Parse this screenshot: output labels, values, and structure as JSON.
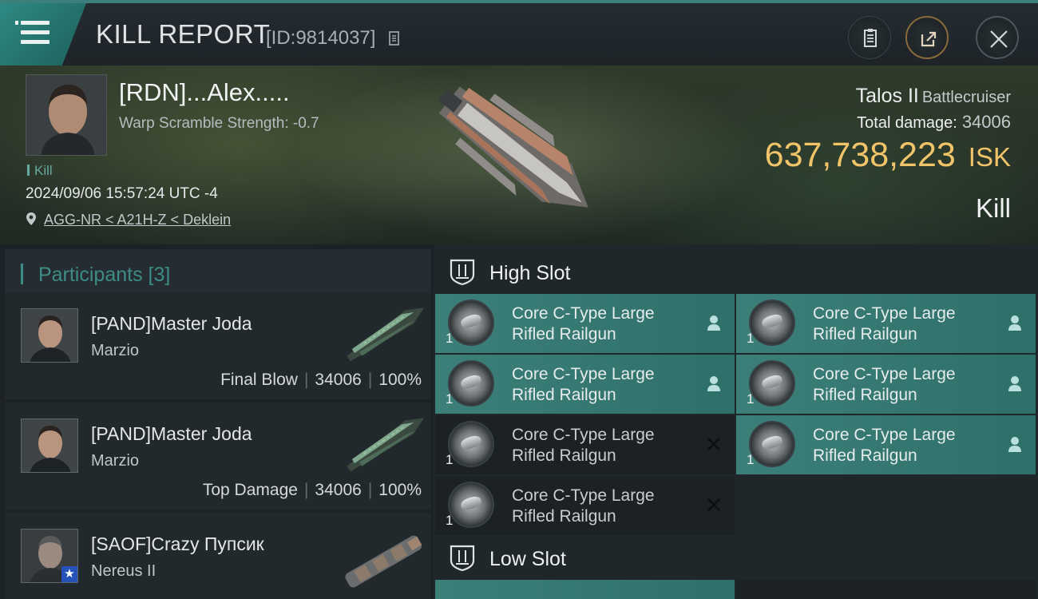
{
  "header": {
    "title": "KILL REPORT",
    "report_id": "[ID:9814037]"
  },
  "victim": {
    "name": "[RDN]...Alex.....",
    "warp_scramble": "Warp Scramble Strength: -0.7",
    "kill_tag": "Kill",
    "datetime": "2024/09/06 15:57:24 UTC -4",
    "location": "AGG-NR < A21H-Z < Deklein",
    "ship": "Talos II",
    "ship_class": "Battlecruiser",
    "total_damage_label": "Total damage:",
    "total_damage": "34006",
    "isk_value": "637,738,223",
    "isk_unit": "ISK",
    "result": "Kill"
  },
  "participants": {
    "label": "Participants",
    "count": "[3]",
    "items": [
      {
        "name": "[PAND]Master Joda",
        "ship": "Marzio",
        "role": "Final Blow",
        "damage": "34006",
        "pct": "100%"
      },
      {
        "name": "[PAND]Master Joda",
        "ship": "Marzio",
        "role": "Top Damage",
        "damage": "34006",
        "pct": "100%"
      },
      {
        "name": "[SAOF]Crazy Пупсик",
        "ship": "Nereus II",
        "role": "",
        "damage": "",
        "pct": ""
      }
    ]
  },
  "slots": {
    "high_label": "High Slot",
    "low_label": "Low Slot",
    "high": [
      {
        "name_l1": "Core C-Type Large",
        "name_l2": "Rifled Railgun",
        "qty": "1",
        "status": "fitted"
      },
      {
        "name_l1": "Core C-Type Large",
        "name_l2": "Rifled Railgun",
        "qty": "1",
        "status": "fitted"
      },
      {
        "name_l1": "Core C-Type Large",
        "name_l2": "Rifled Railgun",
        "qty": "1",
        "status": "fitted"
      },
      {
        "name_l1": "Core C-Type Large",
        "name_l2": "Rifled Railgun",
        "qty": "1",
        "status": "fitted"
      },
      {
        "name_l1": "Core C-Type Large",
        "name_l2": "Rifled Railgun",
        "qty": "1",
        "status": "destroyed"
      },
      {
        "name_l1": "Core C-Type Large",
        "name_l2": "Rifled Railgun",
        "qty": "1",
        "status": "fitted"
      },
      {
        "name_l1": "Core C-Type Large",
        "name_l2": "Rifled Railgun",
        "qty": "1",
        "status": "destroyed"
      }
    ]
  },
  "colors": {
    "accent_teal": "#3d8c86",
    "isk_gold": "#f2c46a",
    "slot_active": "#3c7f79"
  },
  "icons": [
    "menu-icon",
    "copy-icon",
    "clipboard-icon",
    "share-icon",
    "close-icon",
    "location-pin-icon",
    "person-icon",
    "destroyed-x-icon",
    "slot-shield-icon"
  ]
}
